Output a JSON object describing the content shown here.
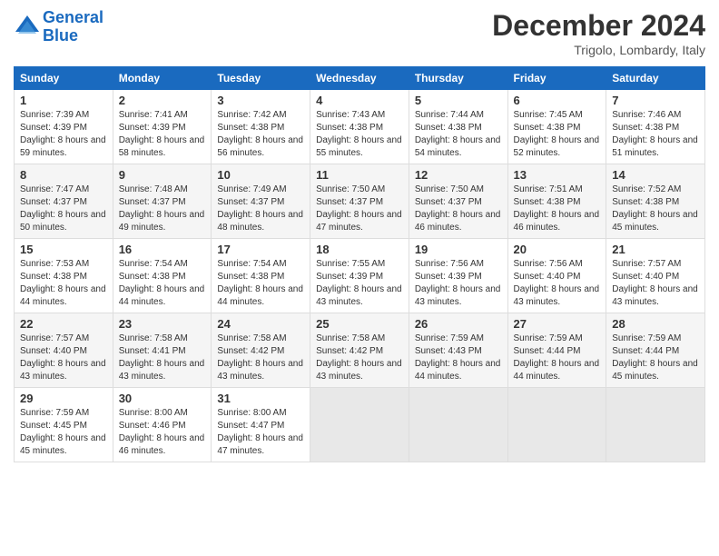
{
  "header": {
    "logo_line1": "General",
    "logo_line2": "Blue",
    "month": "December 2024",
    "location": "Trigolo, Lombardy, Italy"
  },
  "weekdays": [
    "Sunday",
    "Monday",
    "Tuesday",
    "Wednesday",
    "Thursday",
    "Friday",
    "Saturday"
  ],
  "weeks": [
    [
      {
        "day": "1",
        "rise": "Sunrise: 7:39 AM",
        "set": "Sunset: 4:39 PM",
        "light": "Daylight: 8 hours and 59 minutes."
      },
      {
        "day": "2",
        "rise": "Sunrise: 7:41 AM",
        "set": "Sunset: 4:39 PM",
        "light": "Daylight: 8 hours and 58 minutes."
      },
      {
        "day": "3",
        "rise": "Sunrise: 7:42 AM",
        "set": "Sunset: 4:38 PM",
        "light": "Daylight: 8 hours and 56 minutes."
      },
      {
        "day": "4",
        "rise": "Sunrise: 7:43 AM",
        "set": "Sunset: 4:38 PM",
        "light": "Daylight: 8 hours and 55 minutes."
      },
      {
        "day": "5",
        "rise": "Sunrise: 7:44 AM",
        "set": "Sunset: 4:38 PM",
        "light": "Daylight: 8 hours and 54 minutes."
      },
      {
        "day": "6",
        "rise": "Sunrise: 7:45 AM",
        "set": "Sunset: 4:38 PM",
        "light": "Daylight: 8 hours and 52 minutes."
      },
      {
        "day": "7",
        "rise": "Sunrise: 7:46 AM",
        "set": "Sunset: 4:38 PM",
        "light": "Daylight: 8 hours and 51 minutes."
      }
    ],
    [
      {
        "day": "8",
        "rise": "Sunrise: 7:47 AM",
        "set": "Sunset: 4:37 PM",
        "light": "Daylight: 8 hours and 50 minutes."
      },
      {
        "day": "9",
        "rise": "Sunrise: 7:48 AM",
        "set": "Sunset: 4:37 PM",
        "light": "Daylight: 8 hours and 49 minutes."
      },
      {
        "day": "10",
        "rise": "Sunrise: 7:49 AM",
        "set": "Sunset: 4:37 PM",
        "light": "Daylight: 8 hours and 48 minutes."
      },
      {
        "day": "11",
        "rise": "Sunrise: 7:50 AM",
        "set": "Sunset: 4:37 PM",
        "light": "Daylight: 8 hours and 47 minutes."
      },
      {
        "day": "12",
        "rise": "Sunrise: 7:50 AM",
        "set": "Sunset: 4:37 PM",
        "light": "Daylight: 8 hours and 46 minutes."
      },
      {
        "day": "13",
        "rise": "Sunrise: 7:51 AM",
        "set": "Sunset: 4:38 PM",
        "light": "Daylight: 8 hours and 46 minutes."
      },
      {
        "day": "14",
        "rise": "Sunrise: 7:52 AM",
        "set": "Sunset: 4:38 PM",
        "light": "Daylight: 8 hours and 45 minutes."
      }
    ],
    [
      {
        "day": "15",
        "rise": "Sunrise: 7:53 AM",
        "set": "Sunset: 4:38 PM",
        "light": "Daylight: 8 hours and 44 minutes."
      },
      {
        "day": "16",
        "rise": "Sunrise: 7:54 AM",
        "set": "Sunset: 4:38 PM",
        "light": "Daylight: 8 hours and 44 minutes."
      },
      {
        "day": "17",
        "rise": "Sunrise: 7:54 AM",
        "set": "Sunset: 4:38 PM",
        "light": "Daylight: 8 hours and 44 minutes."
      },
      {
        "day": "18",
        "rise": "Sunrise: 7:55 AM",
        "set": "Sunset: 4:39 PM",
        "light": "Daylight: 8 hours and 43 minutes."
      },
      {
        "day": "19",
        "rise": "Sunrise: 7:56 AM",
        "set": "Sunset: 4:39 PM",
        "light": "Daylight: 8 hours and 43 minutes."
      },
      {
        "day": "20",
        "rise": "Sunrise: 7:56 AM",
        "set": "Sunset: 4:40 PM",
        "light": "Daylight: 8 hours and 43 minutes."
      },
      {
        "day": "21",
        "rise": "Sunrise: 7:57 AM",
        "set": "Sunset: 4:40 PM",
        "light": "Daylight: 8 hours and 43 minutes."
      }
    ],
    [
      {
        "day": "22",
        "rise": "Sunrise: 7:57 AM",
        "set": "Sunset: 4:40 PM",
        "light": "Daylight: 8 hours and 43 minutes."
      },
      {
        "day": "23",
        "rise": "Sunrise: 7:58 AM",
        "set": "Sunset: 4:41 PM",
        "light": "Daylight: 8 hours and 43 minutes."
      },
      {
        "day": "24",
        "rise": "Sunrise: 7:58 AM",
        "set": "Sunset: 4:42 PM",
        "light": "Daylight: 8 hours and 43 minutes."
      },
      {
        "day": "25",
        "rise": "Sunrise: 7:58 AM",
        "set": "Sunset: 4:42 PM",
        "light": "Daylight: 8 hours and 43 minutes."
      },
      {
        "day": "26",
        "rise": "Sunrise: 7:59 AM",
        "set": "Sunset: 4:43 PM",
        "light": "Daylight: 8 hours and 44 minutes."
      },
      {
        "day": "27",
        "rise": "Sunrise: 7:59 AM",
        "set": "Sunset: 4:44 PM",
        "light": "Daylight: 8 hours and 44 minutes."
      },
      {
        "day": "28",
        "rise": "Sunrise: 7:59 AM",
        "set": "Sunset: 4:44 PM",
        "light": "Daylight: 8 hours and 45 minutes."
      }
    ],
    [
      {
        "day": "29",
        "rise": "Sunrise: 7:59 AM",
        "set": "Sunset: 4:45 PM",
        "light": "Daylight: 8 hours and 45 minutes."
      },
      {
        "day": "30",
        "rise": "Sunrise: 8:00 AM",
        "set": "Sunset: 4:46 PM",
        "light": "Daylight: 8 hours and 46 minutes."
      },
      {
        "day": "31",
        "rise": "Sunrise: 8:00 AM",
        "set": "Sunset: 4:47 PM",
        "light": "Daylight: 8 hours and 47 minutes."
      },
      null,
      null,
      null,
      null
    ]
  ]
}
